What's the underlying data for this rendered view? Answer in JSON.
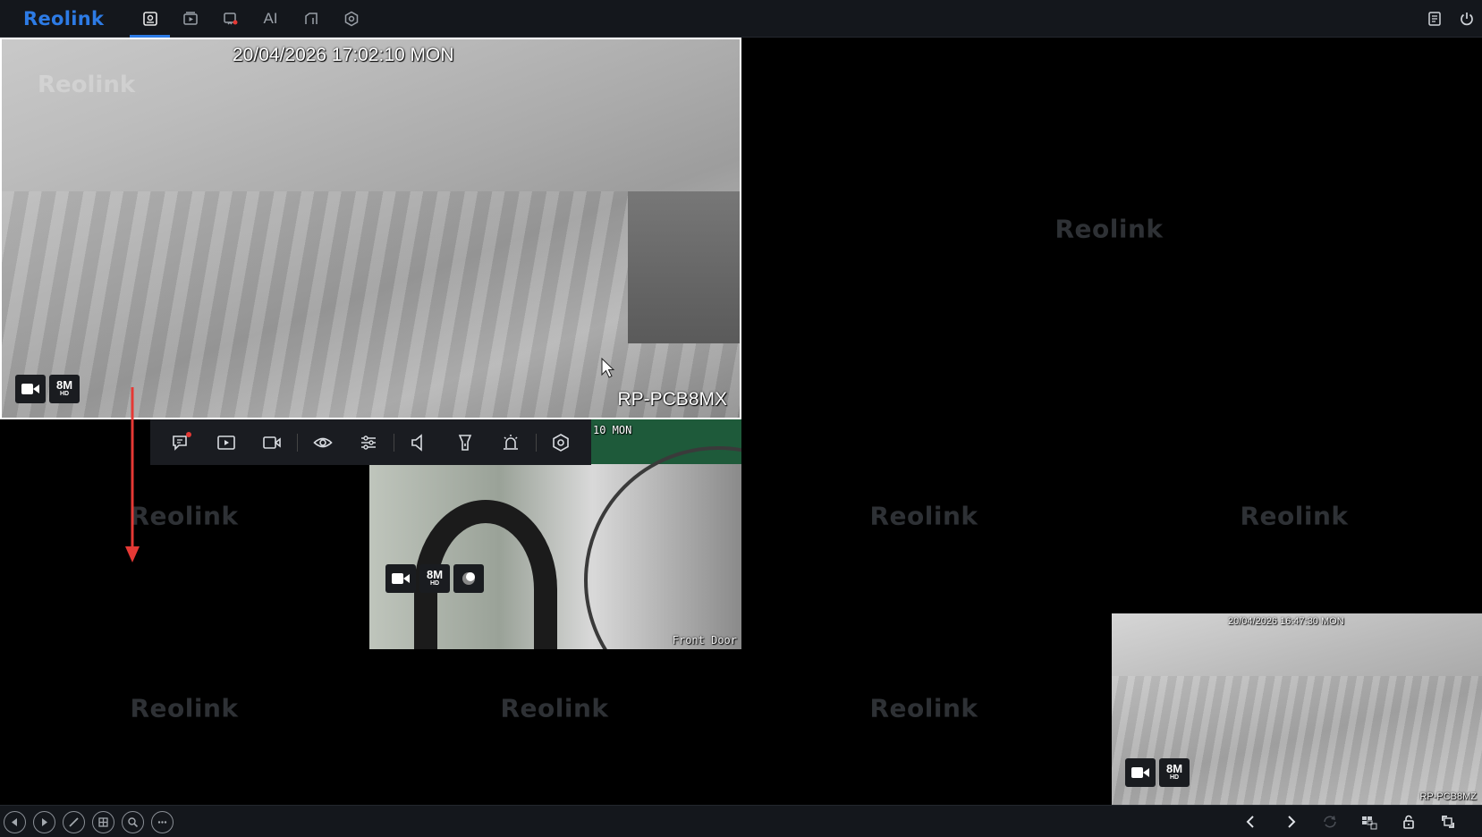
{
  "app": {
    "logo": "Reolink"
  },
  "nav": {
    "ai_label": "AI",
    "active": "live-view"
  },
  "watermark": "Reolink",
  "tiles": {
    "main": {
      "timestamp": "20/04/2026 17:02:10 MON",
      "camera_name": "RP-PCB8MX",
      "resolution": "8M",
      "resolution_sub": "HD"
    },
    "front_door": {
      "timestamp_partial": "10 MON",
      "camera_name": "Front Door",
      "resolution": "8M",
      "resolution_sub": "HD"
    },
    "bottom_right": {
      "timestamp": "20/04/2026 16:47:30 MON",
      "camera_name": "RP-PCB8MZ",
      "resolution": "8M",
      "resolution_sub": "HD"
    }
  },
  "toolbar": {
    "items": [
      "talk-icon",
      "playback-icon",
      "record-icon",
      "visibility-icon",
      "adjust-icon",
      "audio-icon",
      "spotlight-icon",
      "siren-icon",
      "settings-icon"
    ]
  },
  "colors": {
    "accent": "#2d7be5",
    "annotation": "#e53935",
    "selected_border": "#ffffff"
  }
}
